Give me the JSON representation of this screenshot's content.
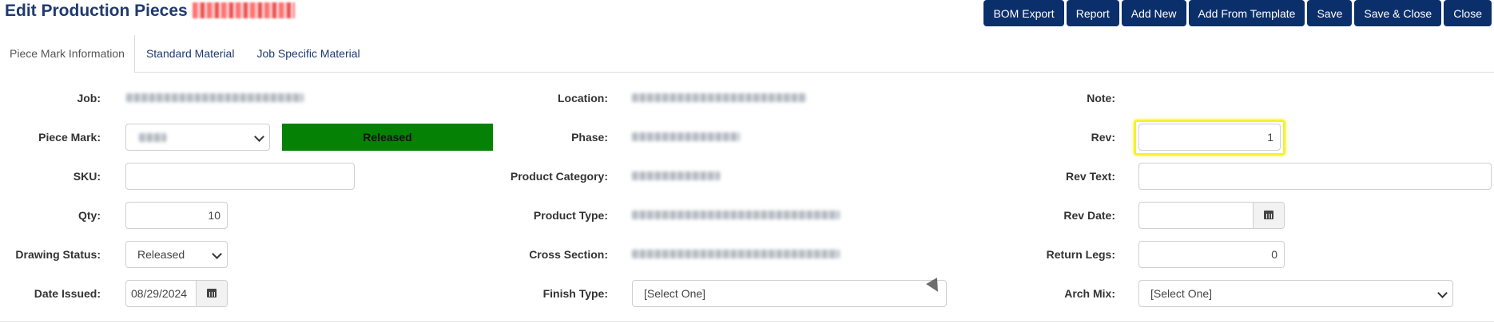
{
  "header": {
    "title": "Edit Production Pieces",
    "toolbar": [
      "BOM Export",
      "Report",
      "Add New",
      "Add From Template",
      "Save",
      "Save & Close",
      "Close"
    ]
  },
  "tabs": [
    "Piece Mark Information",
    "Standard Material",
    "Job Specific Material"
  ],
  "form": {
    "labels": {
      "job": "Job:",
      "piece_mark": "Piece Mark:",
      "sku": "SKU:",
      "qty": "Qty:",
      "drawing_status": "Drawing Status:",
      "date_issued": "Date Issued:",
      "location": "Location:",
      "phase": "Phase:",
      "product_category": "Product Category:",
      "product_type": "Product Type:",
      "cross_section": "Cross Section:",
      "finish_type": "Finish Type:",
      "note": "Note:",
      "rev": "Rev:",
      "rev_text": "Rev Text:",
      "rev_date": "Rev Date:",
      "return_legs": "Return Legs:",
      "arch_mix": "Arch Mix:"
    },
    "values": {
      "status_badge": "Released",
      "qty": "10",
      "drawing_status": "Released",
      "date_issued": "08/29/2024",
      "finish_type": "[Select One]",
      "rev": "1",
      "return_legs": "0",
      "arch_mix": "[Select One]"
    }
  },
  "colors": {
    "button_bg": "#0b2f6b",
    "status_green": "#058105",
    "title_blue": "#1f3a6e",
    "highlight_yellow": "#f2f234"
  }
}
